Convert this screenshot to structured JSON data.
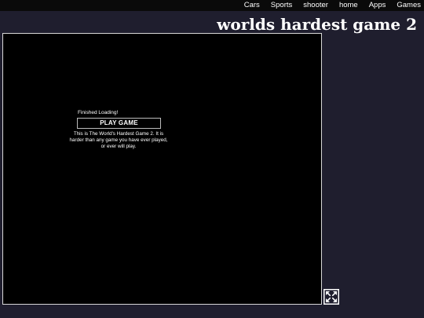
{
  "nav": {
    "items": [
      {
        "label": "Cars"
      },
      {
        "label": "Sports"
      },
      {
        "label": "shooter"
      },
      {
        "label": "home"
      },
      {
        "label": "Apps"
      },
      {
        "label": "Games"
      }
    ]
  },
  "header": {
    "title": "worlds hardest game 2"
  },
  "game": {
    "loading_text": "Finished Loading!",
    "play_label": "PLAY GAME",
    "description": "This is The World's Hardest Game 2. It is harder than any game you have ever played, or ever will play."
  },
  "controls": {
    "fullscreen_icon": "expand-arrows-icon"
  },
  "colors": {
    "background": "#1f1e2e",
    "nav_bar": "#0a0a0a",
    "game_canvas": "#000000",
    "text": "#ffffff"
  }
}
